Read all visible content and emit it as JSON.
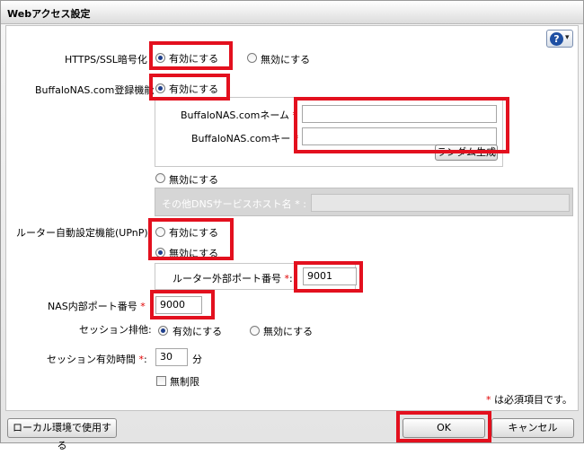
{
  "window": {
    "title": "Webアクセス設定"
  },
  "help": {
    "glyph": "?",
    "caret": "▾"
  },
  "https": {
    "label": "HTTPS/SSL暗号化",
    "enable": "有効にする",
    "disable": "無効にする",
    "selected": "enable"
  },
  "buffalonas": {
    "label": "BuffaloNAS.com登録機能",
    "enable": "有効にする",
    "disable": "無効にする",
    "name_label": "BuffaloNAS.comネーム",
    "key_label": "BuffaloNAS.comキー",
    "name_value": "",
    "key_value": "",
    "keygen_button": "ランダム生成",
    "other_dns_label": "その他DNSサービスホスト名",
    "other_dns_value": "",
    "required_mark": "*",
    "colon": ":"
  },
  "upnp": {
    "label": "ルーター自動設定機能(UPnP)",
    "enable": "有効にする",
    "disable": "無効にする",
    "selected": "disable",
    "external_port_label": "ルーター外部ポート番号",
    "external_port_value": "9001"
  },
  "nas_port": {
    "label": "NAS内部ポート番号",
    "value": "9000"
  },
  "session_exclusive": {
    "label": "セッション排他:",
    "enable": "有効にする",
    "disable": "無効にする",
    "selected": "enable"
  },
  "session_timeout": {
    "label": "セッション有効時間",
    "colon": ":",
    "value": "30",
    "unit": "分",
    "unlimited_label": "無制限",
    "unlimited_checked": false
  },
  "footer": {
    "required_note": "は必須項目です。",
    "local_button": "ローカル環境で使用する",
    "ok_button": "OK",
    "cancel_button": "キャンセル"
  },
  "colors": {
    "highlight": "#e3101e",
    "required": "#e00000",
    "radio_dot": "#1f3f8c"
  }
}
